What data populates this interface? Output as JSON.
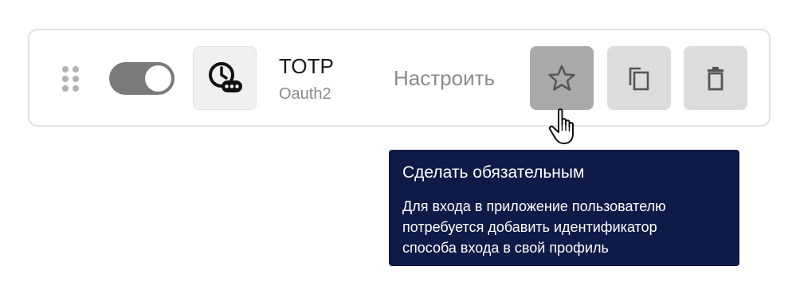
{
  "method": {
    "title": "TOTP",
    "subtitle": "Oauth2",
    "icon": "clock-password-icon",
    "enabled": true
  },
  "actions": {
    "configure_label": "Настроить",
    "make_required_icon": "star-icon",
    "duplicate_icon": "copy-icon",
    "delete_icon": "trash-icon"
  },
  "tooltip": {
    "title": "Сделать обязательным",
    "lines": [
      "Для входа в приложение пользователю",
      "потребуется добавить идентификатор",
      "способа входа в свой профиль"
    ]
  },
  "colors": {
    "tooltip_bg": "#0e1a47",
    "button_bg": "#dcdcdc",
    "button_hover_bg": "#a9a9a9",
    "toggle_on": "#7a7a7a"
  }
}
